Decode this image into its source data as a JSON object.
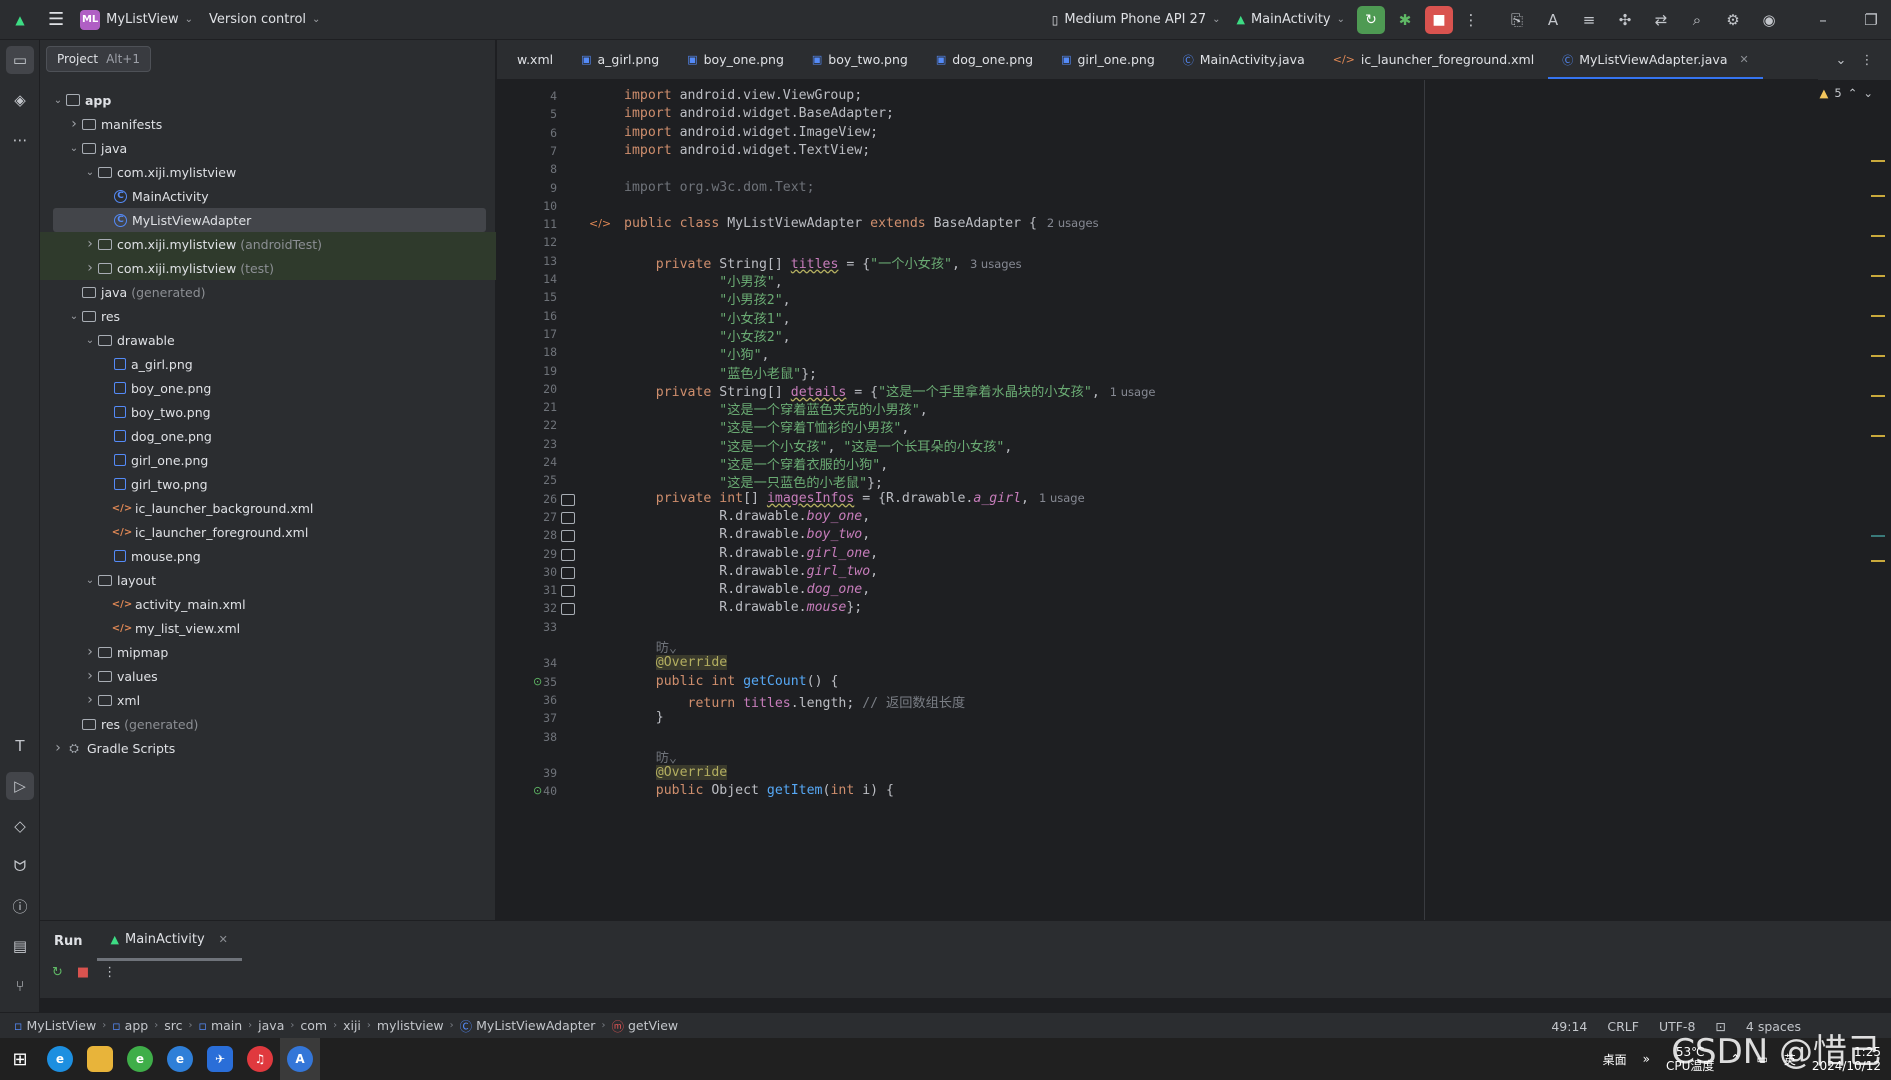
{
  "topbar": {
    "project_badge": "ML",
    "project_name": "MyListView",
    "vcs_label": "Version control",
    "device": "Medium Phone API 27",
    "run_config": "MainActivity"
  },
  "tooltip": {
    "label": "Project",
    "shortcut": "Alt+1"
  },
  "tree": [
    {
      "depth": 0,
      "arrow": "down",
      "icon": "module",
      "label": "app",
      "bold": true
    },
    {
      "depth": 1,
      "arrow": "right",
      "icon": "folder",
      "label": "manifests"
    },
    {
      "depth": 1,
      "arrow": "down",
      "icon": "folder",
      "label": "java"
    },
    {
      "depth": 2,
      "arrow": "down",
      "icon": "folder",
      "label": "com.xiji.mylistview"
    },
    {
      "depth": 3,
      "arrow": "",
      "icon": "class",
      "label": "MainActivity"
    },
    {
      "depth": 3,
      "arrow": "",
      "icon": "class",
      "label": "MyListViewAdapter",
      "selected": true
    },
    {
      "depth": 2,
      "arrow": "right",
      "icon": "folder",
      "label": "com.xiji.mylistview",
      "suffix": "(androidTest)",
      "green": true
    },
    {
      "depth": 2,
      "arrow": "right",
      "icon": "folder",
      "label": "com.xiji.mylistview",
      "suffix": "(test)",
      "green": true
    },
    {
      "depth": 1,
      "arrow": "",
      "icon": "folder",
      "label": "java",
      "suffix": "(generated)"
    },
    {
      "depth": 1,
      "arrow": "down",
      "icon": "folder",
      "label": "res"
    },
    {
      "depth": 2,
      "arrow": "down",
      "icon": "folder",
      "label": "drawable"
    },
    {
      "depth": 3,
      "arrow": "",
      "icon": "img",
      "label": "a_girl.png"
    },
    {
      "depth": 3,
      "arrow": "",
      "icon": "img",
      "label": "boy_one.png"
    },
    {
      "depth": 3,
      "arrow": "",
      "icon": "img",
      "label": "boy_two.png"
    },
    {
      "depth": 3,
      "arrow": "",
      "icon": "img",
      "label": "dog_one.png"
    },
    {
      "depth": 3,
      "arrow": "",
      "icon": "img",
      "label": "girl_one.png"
    },
    {
      "depth": 3,
      "arrow": "",
      "icon": "img",
      "label": "girl_two.png"
    },
    {
      "depth": 3,
      "arrow": "",
      "icon": "xml",
      "label": "ic_launcher_background.xml"
    },
    {
      "depth": 3,
      "arrow": "",
      "icon": "xml",
      "label": "ic_launcher_foreground.xml"
    },
    {
      "depth": 3,
      "arrow": "",
      "icon": "img",
      "label": "mouse.png"
    },
    {
      "depth": 2,
      "arrow": "down",
      "icon": "folder",
      "label": "layout"
    },
    {
      "depth": 3,
      "arrow": "",
      "icon": "xml",
      "label": "activity_main.xml"
    },
    {
      "depth": 3,
      "arrow": "",
      "icon": "xml",
      "label": "my_list_view.xml"
    },
    {
      "depth": 2,
      "arrow": "right",
      "icon": "folder",
      "label": "mipmap"
    },
    {
      "depth": 2,
      "arrow": "right",
      "icon": "folder",
      "label": "values"
    },
    {
      "depth": 2,
      "arrow": "right",
      "icon": "folder",
      "label": "xml"
    },
    {
      "depth": 1,
      "arrow": "",
      "icon": "folder",
      "label": "res",
      "suffix": "(generated)"
    },
    {
      "depth": 0,
      "arrow": "right",
      "icon": "gradle",
      "label": "Gradle Scripts"
    }
  ],
  "tabs": [
    {
      "label": "w.xml",
      "icon": "xml"
    },
    {
      "label": "a_girl.png",
      "icon": "img"
    },
    {
      "label": "boy_one.png",
      "icon": "img"
    },
    {
      "label": "boy_two.png",
      "icon": "img"
    },
    {
      "label": "dog_one.png",
      "icon": "img"
    },
    {
      "label": "girl_one.png",
      "icon": "img"
    },
    {
      "label": "MainActivity.java",
      "icon": "class"
    },
    {
      "label": "ic_launcher_foreground.xml",
      "icon": "xml"
    },
    {
      "label": "MyListViewAdapter.java",
      "icon": "class",
      "active": true
    }
  ],
  "editor": {
    "warnings": "5",
    "lines": [
      {
        "n": "4",
        "code": [
          [
            "kw",
            "import "
          ],
          [
            "",
            "android.view.ViewGroup;"
          ]
        ]
      },
      {
        "n": "5",
        "code": [
          [
            "kw",
            "import "
          ],
          [
            "",
            "android.widget.BaseAdapter;"
          ]
        ]
      },
      {
        "n": "6",
        "code": [
          [
            "kw",
            "import "
          ],
          [
            "",
            "android.widget.ImageView;"
          ]
        ]
      },
      {
        "n": "7",
        "code": [
          [
            "kw",
            "import "
          ],
          [
            "",
            "android.widget.TextView;"
          ]
        ]
      },
      {
        "n": "8",
        "code": []
      },
      {
        "n": "9",
        "code": [
          [
            "grey",
            "import org.w3c.dom.Text;"
          ]
        ]
      },
      {
        "n": "10",
        "code": []
      },
      {
        "n": "11",
        "code": [
          [
            "kw",
            "public class "
          ],
          [
            "",
            "MyListViewAdapter "
          ],
          [
            "kw",
            "extends "
          ],
          [
            "",
            "BaseAdapter {"
          ],
          [
            "hint",
            "2 usages"
          ]
        ]
      },
      {
        "n": "12",
        "code": []
      },
      {
        "n": "13",
        "code": [
          [
            "",
            "    "
          ],
          [
            "kw",
            "private "
          ],
          [
            "",
            "String[] "
          ],
          [
            "fldu",
            "titles"
          ],
          [
            "",
            " = {"
          ],
          [
            "str",
            "\"一个小女孩\""
          ],
          [
            "",
            ","
          ],
          [
            "hint",
            "3 usages"
          ]
        ]
      },
      {
        "n": "14",
        "code": [
          [
            "",
            "            "
          ],
          [
            "str",
            "\"小男孩\""
          ],
          [
            "",
            ","
          ]
        ]
      },
      {
        "n": "15",
        "code": [
          [
            "",
            "            "
          ],
          [
            "str",
            "\"小男孩2\""
          ],
          [
            "",
            ","
          ]
        ]
      },
      {
        "n": "16",
        "code": [
          [
            "",
            "            "
          ],
          [
            "str",
            "\"小女孩1\""
          ],
          [
            "",
            ","
          ]
        ]
      },
      {
        "n": "17",
        "code": [
          [
            "",
            "            "
          ],
          [
            "str",
            "\"小女孩2\""
          ],
          [
            "",
            ","
          ]
        ]
      },
      {
        "n": "18",
        "code": [
          [
            "",
            "            "
          ],
          [
            "str",
            "\"小狗\""
          ],
          [
            "",
            ","
          ]
        ]
      },
      {
        "n": "19",
        "code": [
          [
            "",
            "            "
          ],
          [
            "str",
            "\"蓝色小老鼠\""
          ],
          [
            "",
            "};"
          ]
        ]
      },
      {
        "n": "20",
        "code": [
          [
            "",
            "    "
          ],
          [
            "kw",
            "private "
          ],
          [
            "",
            "String[] "
          ],
          [
            "fldu",
            "details"
          ],
          [
            "",
            " = {"
          ],
          [
            "str",
            "\"这是一个手里拿着水晶块的小女孩\""
          ],
          [
            "",
            ","
          ],
          [
            "hint",
            "1 usage"
          ]
        ]
      },
      {
        "n": "21",
        "code": [
          [
            "",
            "            "
          ],
          [
            "str",
            "\"这是一个穿着蓝色夹克的小男孩\""
          ],
          [
            "",
            ","
          ]
        ]
      },
      {
        "n": "22",
        "code": [
          [
            "",
            "            "
          ],
          [
            "str",
            "\"这是一个穿着T恤衫的小男孩\""
          ],
          [
            "",
            ","
          ]
        ]
      },
      {
        "n": "23",
        "code": [
          [
            "",
            "            "
          ],
          [
            "str",
            "\"这是一个小女孩\""
          ],
          [
            "",
            ", "
          ],
          [
            "str",
            "\"这是一个长耳朵的小女孩\""
          ],
          [
            "",
            ","
          ]
        ]
      },
      {
        "n": "24",
        "code": [
          [
            "",
            "            "
          ],
          [
            "str",
            "\"这是一个穿着衣服的小狗\""
          ],
          [
            "",
            ","
          ]
        ]
      },
      {
        "n": "25",
        "code": [
          [
            "",
            "            "
          ],
          [
            "str",
            "\"这是一只蓝色的小老鼠\""
          ],
          [
            "",
            "};"
          ]
        ]
      },
      {
        "n": "26",
        "code": [
          [
            "",
            "    "
          ],
          [
            "kw",
            "private int"
          ],
          [
            "",
            "[] "
          ],
          [
            "fldu",
            "imagesInfos"
          ],
          [
            "",
            " = {R.drawable."
          ],
          [
            "ital",
            "a_girl"
          ],
          [
            "",
            ","
          ],
          [
            "hint",
            "1 usage"
          ]
        ]
      },
      {
        "n": "27",
        "code": [
          [
            "",
            "            R.drawable."
          ],
          [
            "ital",
            "boy_one"
          ],
          [
            "",
            ","
          ]
        ]
      },
      {
        "n": "28",
        "code": [
          [
            "",
            "            R.drawable."
          ],
          [
            "ital",
            "boy_two"
          ],
          [
            "",
            ","
          ]
        ]
      },
      {
        "n": "29",
        "code": [
          [
            "",
            "            R.drawable."
          ],
          [
            "ital",
            "girl_one"
          ],
          [
            "",
            ","
          ]
        ]
      },
      {
        "n": "30",
        "code": [
          [
            "",
            "            R.drawable."
          ],
          [
            "ital",
            "girl_two"
          ],
          [
            "",
            ","
          ]
        ]
      },
      {
        "n": "31",
        "code": [
          [
            "",
            "            R.drawable."
          ],
          [
            "ital",
            "dog_one"
          ],
          [
            "",
            ","
          ]
        ]
      },
      {
        "n": "32",
        "code": [
          [
            "",
            "            R.drawable."
          ],
          [
            "ital",
            "mouse"
          ],
          [
            "",
            "};"
          ]
        ]
      },
      {
        "n": "33",
        "code": []
      },
      {
        "n": "",
        "code": [
          [
            "",
            "    "
          ],
          [
            "grey",
            "昉⌄"
          ]
        ]
      },
      {
        "n": "34",
        "code": [
          [
            "",
            "    "
          ],
          [
            "ann",
            "@Override"
          ]
        ]
      },
      {
        "n": "35",
        "code": [
          [
            "",
            "    "
          ],
          [
            "kw",
            "public int "
          ],
          [
            "fn",
            "getCount"
          ],
          [
            "",
            "() {"
          ]
        ]
      },
      {
        "n": "36",
        "code": [
          [
            "",
            "        "
          ],
          [
            "kw",
            "return "
          ],
          [
            "fld",
            "titles"
          ],
          [
            "",
            ".length; "
          ],
          [
            "cmt",
            "// 返回数组长度"
          ]
        ]
      },
      {
        "n": "37",
        "code": [
          [
            "",
            "    }"
          ]
        ]
      },
      {
        "n": "38",
        "code": []
      },
      {
        "n": "",
        "code": [
          [
            "",
            "    "
          ],
          [
            "grey",
            "昉⌄"
          ]
        ]
      },
      {
        "n": "39",
        "code": [
          [
            "",
            "    "
          ],
          [
            "ann",
            "@Override"
          ]
        ]
      },
      {
        "n": "40",
        "code": [
          [
            "",
            "    "
          ],
          [
            "kw",
            "public "
          ],
          [
            "",
            "Object "
          ],
          [
            "fn",
            "getItem"
          ],
          [
            "",
            "("
          ],
          [
            "kw",
            "int "
          ],
          [
            "",
            "i) {"
          ]
        ]
      }
    ]
  },
  "run": {
    "title": "Run",
    "tab": "MainActivity"
  },
  "status": {
    "crumbs": [
      "MyListView",
      "app",
      "src",
      "main",
      "java",
      "com",
      "xiji",
      "mylistview",
      "MyListViewAdapter",
      "getView"
    ],
    "position": "49:14",
    "line_sep": "CRLF",
    "encoding": "UTF-8",
    "indent": "4 spaces"
  },
  "taskbar": {
    "desktop": "桌面",
    "temp": "53℃",
    "temp_label": "CPU温度",
    "ime": "英",
    "time": "1:25",
    "date": "2024/10/12"
  },
  "watermark": "CSDN @惜己"
}
